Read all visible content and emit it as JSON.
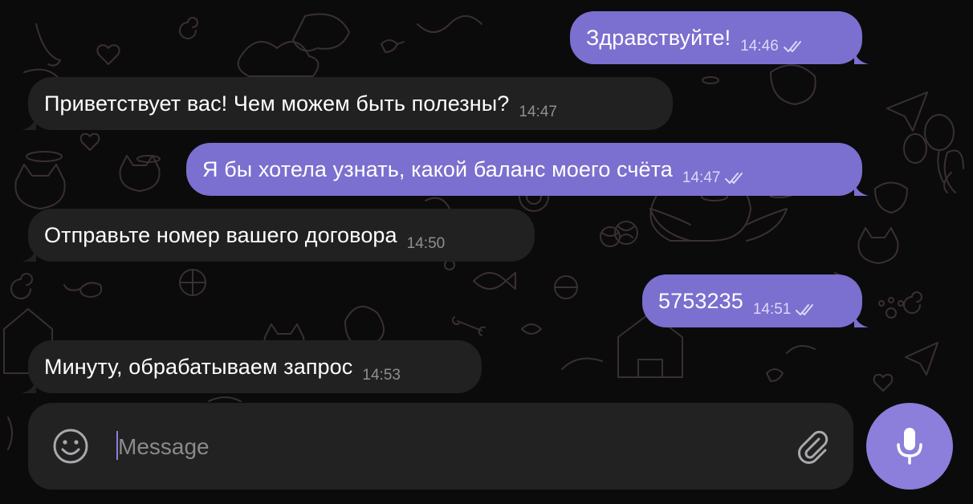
{
  "colors": {
    "background": "#0b0b0c",
    "incoming_bubble": "#212121",
    "outgoing_bubble": "#7b6fcf",
    "accent": "#8b7fdb",
    "input_bar": "#222222"
  },
  "messages": [
    {
      "direction": "outgoing",
      "text": "Здравствуйте!",
      "time": "14:46",
      "status": "read"
    },
    {
      "direction": "incoming",
      "text": "Приветствует вас! Чем можем быть полезны?",
      "time": "14:47"
    },
    {
      "direction": "outgoing",
      "text": "Я бы хотела узнать, какой баланс моего счёта",
      "time": "14:47",
      "status": "read"
    },
    {
      "direction": "incoming",
      "text": "Отправьте номер вашего договора",
      "time": "14:50"
    },
    {
      "direction": "outgoing",
      "text": "5753235",
      "time": "14:51",
      "status": "read"
    },
    {
      "direction": "incoming",
      "text": "Минуту, обрабатываем запрос",
      "time": "14:53"
    }
  ],
  "composer": {
    "placeholder": "Message",
    "value": "",
    "emoji_icon": "smiley-icon",
    "attach_icon": "paperclip-icon",
    "send_icon": "microphone-icon"
  }
}
